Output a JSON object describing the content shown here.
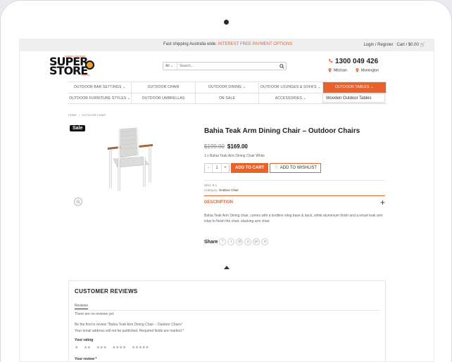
{
  "topbar": {
    "shipping_text": "Fast shipping Australia wide:",
    "promo_text": "INTEREST FREE PAYMENT OPTIONS",
    "account_text": "Login / Register",
    "cart_text": "Cart / $0.00"
  },
  "logo": {
    "small_text": "outdoor furniture",
    "line1": "SUPER",
    "line2": "STORE",
    "tag": "com.au"
  },
  "search": {
    "category": "All",
    "placeholder": "Search..."
  },
  "contact": {
    "phone": "1300 049 426",
    "stores": [
      "Mitcham",
      "Mornington"
    ]
  },
  "nav": {
    "row1": [
      "OUTDOOR BAR SETTINGS ⌄",
      "OUTDOOR CHAIR",
      "OUTDOOR DINING ⌄",
      "OUTDOOR LOUNGES & SOFA'S ⌄",
      "OUTDOOR TABLES ⌄"
    ],
    "row2": [
      "OUTDOOR FURNITURE STYLES ⌄",
      "OUTDOOR UMBRELLAS",
      "ON SALE",
      "ACCESSORIES ⌄",
      ""
    ],
    "dropdown_item": "Wooden Outdoor Tables"
  },
  "breadcrumb": {
    "home": "HOME",
    "separator": "/",
    "current": "OUTDOOR CHAIR"
  },
  "product": {
    "sale_badge": "Sale",
    "title": "Bahia Teak Arm Dining Chair – Outdoor Chairs",
    "old_price": "$199.00",
    "new_price": "$169.00",
    "variant": "1 x Bahia Teak Arm Dining Chair White",
    "quantity": "1",
    "minus": "-",
    "plus": "+",
    "add_to_cart": "ADD TO CART",
    "add_to_wishlist": "ADD TO WISHLIST",
    "sku_label": "SKU: 6-1",
    "category_label": "Category:",
    "category_value": "Outdoor Chair",
    "description_header": "DESCRIPTION",
    "description": "Bahia Teak Arm Dining chair, comes with a textiline sling base & back, white aluminium finish and a smart teak arm inlay to finish the chair, stacking arm chair.",
    "share_label": "Share",
    "share_icons": [
      "f",
      "t",
      "@",
      "p",
      "g+",
      "in"
    ]
  },
  "reviews": {
    "heading": "CUSTOMER REVIEWS",
    "tab": "Reviews",
    "none_text": "There are no reviews yet.",
    "first_text": "Be the first to review “Bahia Teak Arm Dining Chair – Outdoor Chairs”",
    "email_note": "Your email address will not be published. Required fields are marked *",
    "rating_label": "Your rating",
    "stars": [
      "★",
      "★★",
      "★★★",
      "★★★★",
      "★★★★★"
    ],
    "review_label": "Your review *"
  },
  "colors": {
    "accent": "#e8632c",
    "dark": "#111111"
  }
}
